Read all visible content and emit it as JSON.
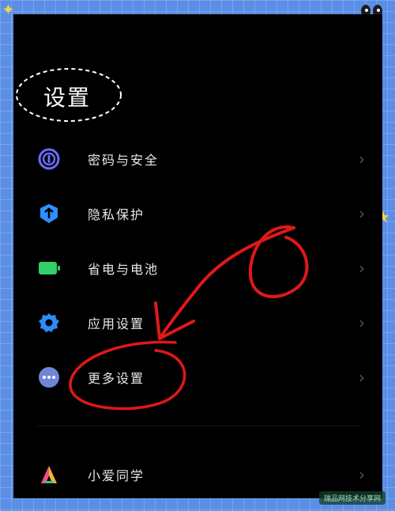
{
  "header": {
    "title": "设置"
  },
  "menu": {
    "items": [
      {
        "label": "密码与安全",
        "icon": "fingerprint-icon",
        "color": "#6a6cff"
      },
      {
        "label": "隐私保护",
        "icon": "shield-icon",
        "color": "#2e8fff"
      },
      {
        "label": "省电与电池",
        "icon": "battery-icon",
        "color": "#31d06b"
      },
      {
        "label": "应用设置",
        "icon": "gear-icon",
        "color": "#2b8cf5"
      },
      {
        "label": "更多设置",
        "icon": "more-icon",
        "color": "#6f86d8"
      },
      {
        "label": "小爱同学",
        "icon": "xiaoai-icon",
        "color": "#f2b23a"
      }
    ]
  },
  "annotation": {
    "color": "#e01818"
  },
  "watermark": {
    "text": "瑞品网技术分享网"
  }
}
